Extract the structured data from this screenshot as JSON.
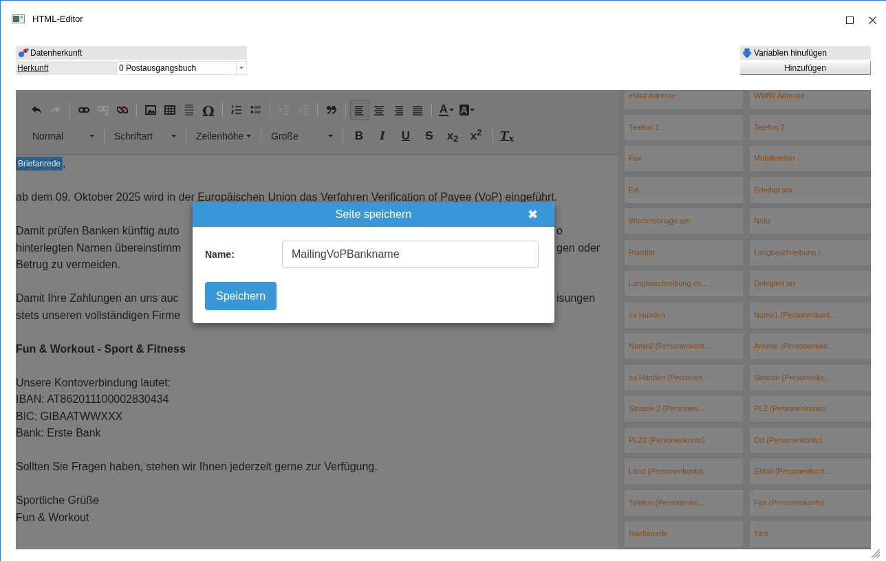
{
  "window": {
    "title": "HTML-Editor"
  },
  "data_source": {
    "title": "Datenherkunft",
    "field_label": "Herkunft",
    "field_value": "0 Postausgangsbuch"
  },
  "variables_header": {
    "title": "Variablen hinufügen",
    "button": "Hinzufügen"
  },
  "toolbar": {
    "buttons": [
      {
        "disabled": false
      },
      {
        "disabled": true
      },
      {
        "disabled": false
      },
      {
        "disabled": true
      },
      {
        "disabled": false
      },
      {
        "disabled": false
      },
      {
        "disabled": false
      },
      {
        "disabled": false
      },
      {
        "disabled": false,
        "glyph": "Ω"
      },
      {
        "disabled": false
      },
      {
        "disabled": false
      },
      {
        "disabled": true
      },
      {
        "disabled": true
      },
      {
        "disabled": false
      }
    ],
    "alignment": [
      {
        "selected": true
      },
      {
        "selected": false
      },
      {
        "selected": false
      },
      {
        "selected": false
      }
    ],
    "color_buttons": [
      {
        "glyph": "A"
      },
      {
        "glyph": "A"
      }
    ],
    "dropdowns": [
      {
        "label": "Normal"
      },
      {
        "label": "Schriftart"
      },
      {
        "label": "Zeilenhöhe"
      },
      {
        "label": "Größe"
      }
    ],
    "format_buttons": [
      {
        "glyph": "B"
      },
      {
        "glyph": "I"
      },
      {
        "glyph": "U"
      },
      {
        "glyph": "S"
      },
      {
        "glyph": "x$_{2}$"
      },
      {
        "glyph": "x$^{2}$"
      }
    ],
    "clear_button": {
      "glyph": "T$_{x}$"
    }
  },
  "editor_lines": [
    {
      "kind": "salutation",
      "badge": "Briefanrede",
      "text": ","
    },
    {
      "kind": "blank"
    },
    {
      "kind": "text",
      "text": "ab dem 09. Oktober 2025 wird in der Europäischen Union das Verfahren Verification of Payee (VoP) eingeführt."
    },
    {
      "kind": "blank"
    },
    {
      "kind": "text",
      "text": "Damit prüfen Banken künftig auto",
      "right": "o"
    },
    {
      "kind": "text",
      "text": "hinterlegten Namen übereinstimm",
      "right": "gen oder"
    },
    {
      "kind": "text",
      "text": "Betrug zu vermeiden."
    },
    {
      "kind": "blank"
    },
    {
      "kind": "text",
      "text": "Damit Ihre Zahlungen an uns auc",
      "right": "isungen"
    },
    {
      "kind": "text",
      "text": "stets unseren vollständigen Firme"
    },
    {
      "kind": "blank"
    },
    {
      "kind": "bold",
      "text": "Fun & Workout - Sport & Fitness"
    },
    {
      "kind": "blank"
    },
    {
      "kind": "text",
      "text": "Unsere Kontoverbindung lautet:"
    },
    {
      "kind": "text",
      "text": "IBAN: AT862011100002830434"
    },
    {
      "kind": "text",
      "text": "BIC: GIBAATWWXXX"
    },
    {
      "kind": "text",
      "text": "Bank: Erste Bank"
    },
    {
      "kind": "blank"
    },
    {
      "kind": "text",
      "text": "Sollten Sie Fragen haben, stehen wir Ihnen jederzeit gerne zur Verfügung."
    },
    {
      "kind": "blank"
    },
    {
      "kind": "text",
      "text": "Sportliche Grüße"
    },
    {
      "kind": "text",
      "text": "Fun & Workout"
    }
  ],
  "variables": [
    "eMail Adresse",
    "WWW Adresse",
    "Telefon 1",
    "Telefon 2",
    "Fax",
    "Mobiltelefon",
    "Erl.",
    "Erledigt am",
    "Wiedervorlage am",
    "Notiz",
    "Priorität",
    "Langbeschreibung i...",
    "Langbeschreibung ex...",
    "Delegiert an",
    "zu Handen",
    "Name1 (Personenkont...",
    "Name2 (Personenkont...",
    "Anrede (Personenkon...",
    "zu Handen (Personen...",
    "Strasse (Personenko...",
    "Strasse 2 (Personen...",
    "PLZ (Personenkonto)",
    "PLZ2 (Personenkonto)",
    "Ort (Personenkonto)",
    "Land (Personenkonto)",
    "EMail (Personenkont...",
    "Telefon (Personenko...",
    "Fax (Personenkonto)",
    "Briefanrede",
    "Titel"
  ],
  "dialog": {
    "title": "Seite speichern",
    "close": "✖",
    "name_label": "Name:",
    "name_value": "MailingVoPBankname",
    "save_button": "Speichern"
  }
}
